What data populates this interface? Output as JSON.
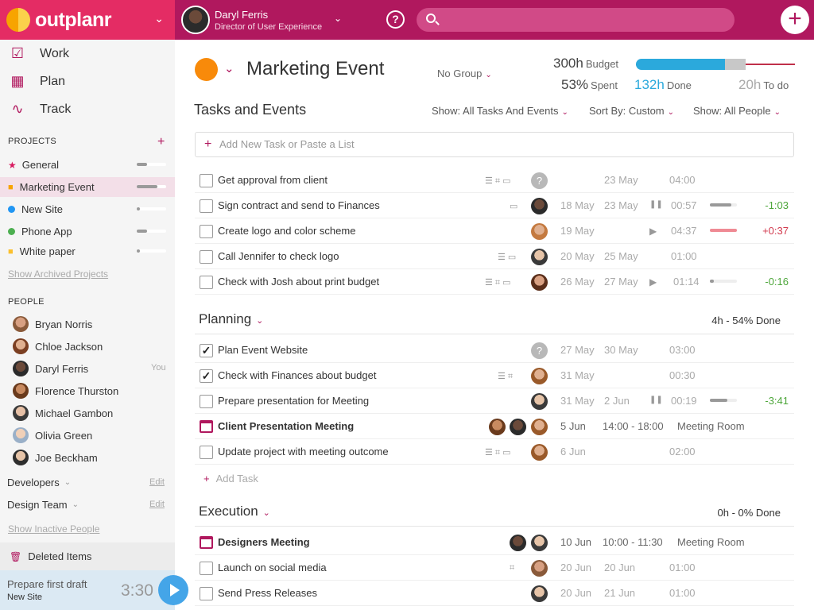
{
  "app": {
    "name": "outplanr"
  },
  "user": {
    "name": "Daryl Ferris",
    "role": "Director of User Experience"
  },
  "search": {
    "placeholder": ""
  },
  "nav": [
    {
      "label": "Work",
      "icon": "checkbox-pencil-icon"
    },
    {
      "label": "Plan",
      "icon": "calendar-clock-icon"
    },
    {
      "label": "Track",
      "icon": "pulse-icon"
    }
  ],
  "sidebar": {
    "projects_title": "PROJECTS",
    "projects": [
      {
        "name": "General",
        "color": "#d81b60",
        "progress": 0.35
      },
      {
        "name": "Marketing Event",
        "color": "#f7a400",
        "progress": 0.7
      },
      {
        "name": "New Site",
        "color": "#2196f3",
        "progress": 0.1
      },
      {
        "name": "Phone App",
        "color": "#4caf50",
        "progress": 0.35
      },
      {
        "name": "White paper",
        "color": "#fbc02d",
        "progress": 0.1
      }
    ],
    "show_archived": "Show Archived Projects",
    "people_title": "PEOPLE",
    "people": [
      {
        "name": "Bryan Norris",
        "you": ""
      },
      {
        "name": "Chloe Jackson",
        "you": ""
      },
      {
        "name": "Daryl Ferris",
        "you": "You"
      },
      {
        "name": "Florence Thurston",
        "you": ""
      },
      {
        "name": "Michael Gambon",
        "you": ""
      },
      {
        "name": "Olivia Green",
        "you": ""
      },
      {
        "name": "Joe Beckham",
        "you": ""
      }
    ],
    "teams": [
      {
        "name": "Developers",
        "edit": "Edit"
      },
      {
        "name": "Design Team",
        "edit": "Edit"
      }
    ],
    "show_inactive": "Show Inactive People",
    "deleted": "Deleted Items",
    "timer": {
      "task": "Prepare first draft",
      "project": "New Site",
      "time": "3:30"
    }
  },
  "project": {
    "title": "Marketing Event",
    "color": "#f88a0a",
    "group": "No Group",
    "budget_value": "300h",
    "budget_label": "Budget",
    "spent_value": "53%",
    "spent_label": "Spent",
    "done_value": "132h",
    "done_label": "Done",
    "todo_value": "20h",
    "todo_label": "To do"
  },
  "tasks_header": "Tasks and Events",
  "filters": {
    "show": "Show: All Tasks And Events",
    "sort": "Sort By: Custom",
    "people": "Show: All People"
  },
  "add_task_placeholder": "Add New Task or Paste a List",
  "add_task_label": "Add Task",
  "task_rows": [
    {
      "name": "Get approval from client",
      "icons": "☰ ⌗ ▭",
      "avatar": "unknown",
      "start": "",
      "end": "23 May",
      "dur": "04:00",
      "status": "",
      "progress": null,
      "diff": ""
    },
    {
      "name": "Sign contract and send to Finances",
      "icons": "▭",
      "avatar": "man-dark",
      "start": "18 May",
      "end": "23 May",
      "dur": "00:57",
      "status": "pause",
      "progress": 0.8,
      "diff": "-1:03"
    },
    {
      "name": "Create logo and color scheme",
      "icons": "",
      "avatar": "woman-curly",
      "start": "19 May",
      "end": "",
      "dur": "04:37",
      "status": "play",
      "progress": 1.0,
      "diff": "+0:37"
    },
    {
      "name": "Call Jennifer to check logo",
      "icons": "☰ ▭",
      "avatar": "man-beard",
      "start": "20 May",
      "end": "25 May",
      "dur": "01:00",
      "status": "",
      "progress": null,
      "diff": ""
    },
    {
      "name": "Check with Josh about print budget",
      "icons": "☰ ⌗ ▭",
      "avatar": "woman-dark",
      "start": "26 May",
      "end": "27 May",
      "dur": "01:14",
      "status": "play",
      "progress": 0.15,
      "diff": "-0:16"
    }
  ],
  "planning": {
    "title": "Planning",
    "progress": "4h - 54% Done",
    "rows": [
      {
        "name": "Plan Event Website",
        "checked": "✓",
        "icons": "",
        "start": "27 May",
        "end": "30 May",
        "dur": "03:00",
        "diff": ""
      },
      {
        "name": "Check with Finances about budget",
        "checked": "✓",
        "icons": "☰ ⌗",
        "start": "31 May",
        "end": "",
        "dur": "00:30",
        "diff": ""
      },
      {
        "name": "Prepare presentation for Meeting",
        "checked": "",
        "icons": "",
        "start": "31 May",
        "end": "2 Jun",
        "dur": "00:19",
        "diff": "-3:41"
      },
      {
        "name": "Client Presentation Meeting",
        "checked": "",
        "icons": "",
        "start": "5 Jun",
        "end": "14:00 - 18:00",
        "dur": "Meeting Room",
        "diff": ""
      },
      {
        "name": "Update project with meeting outcome",
        "checked": "",
        "icons": "☰ ⌗ ▭",
        "start": "6 Jun",
        "end": "",
        "dur": "02:00",
        "diff": ""
      }
    ]
  },
  "execution": {
    "title": "Execution",
    "progress": "0h - 0% Done",
    "rows": [
      {
        "name": "Designers Meeting",
        "icons": "",
        "start": "10 Jun",
        "end": "10:00 - 11:30",
        "dur": "Meeting Room"
      },
      {
        "name": "Launch on social media",
        "icons": "⌗",
        "start": "20 Jun",
        "end": "20 Jun",
        "dur": "01:00"
      },
      {
        "name": "Send Press Releases",
        "icons": "",
        "start": "20 Jun",
        "end": "21 Jun",
        "dur": "01:00"
      }
    ]
  },
  "colors": {
    "brand": "#e42c64",
    "topbar": "#b0185e",
    "accent": "#b0185e",
    "done_blue": "#2ba9dc",
    "positive": "#4da63a",
    "negative": "#d23a4e"
  }
}
